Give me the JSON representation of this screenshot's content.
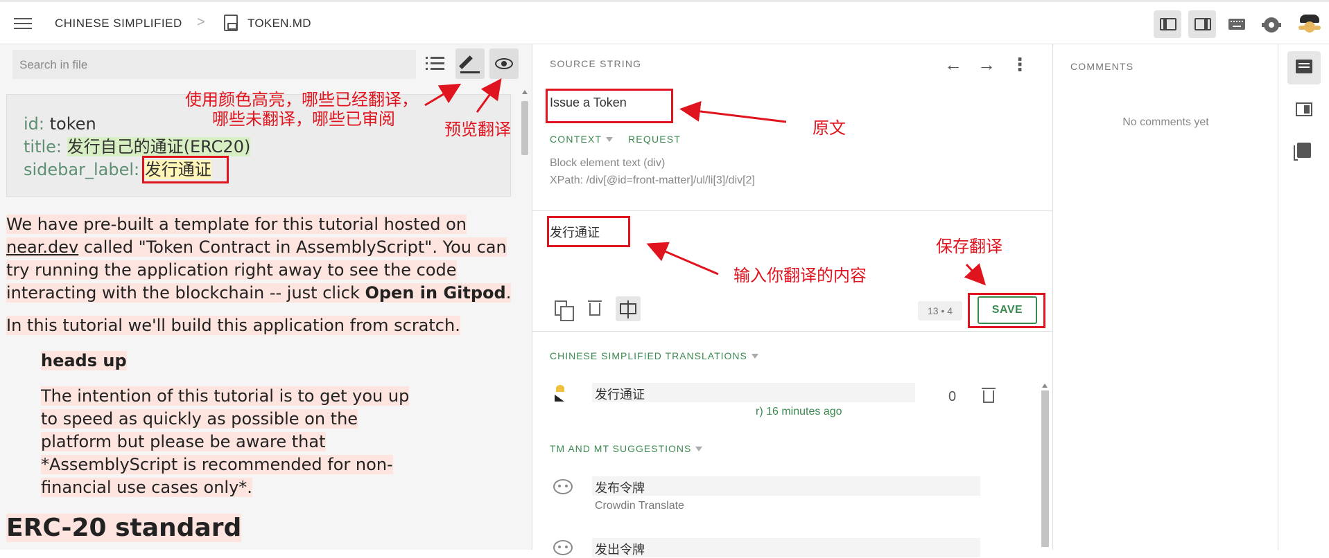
{
  "header": {
    "language": "CHINESE SIMPLIFIED",
    "separator": ">",
    "file": "TOKEN.MD",
    "icons": [
      "menu-icon",
      "file-icon",
      "layout-left-icon",
      "layout-right-icon",
      "keyboard-icon",
      "gear-icon",
      "avatar"
    ]
  },
  "left": {
    "search_placeholder": "Search in file",
    "front_matter": [
      {
        "key": "id:",
        "value": "token"
      },
      {
        "key": "title:",
        "value": "发行自己的通证(ERC20)"
      },
      {
        "key": "sidebar_label:",
        "value": "发行通证"
      }
    ],
    "para1_a": "We have pre-built a template for this tutorial hosted on",
    "para1_link": "near.dev",
    "para1_b": " called \"Token Contract in AssemblyScript\". You can try running the application right away to see the code interacting with the blockchain -- just click ",
    "para1_bold": "Open in Gitpod",
    "para1_end": ".",
    "para2": "In this tutorial we'll build this application from scratch.",
    "note_title": "heads up",
    "note_body": "The intention of this tutorial is to get you up to speed as quickly as possible on the platform but please be aware that *AssemblyScript is recommended for non-financial use cases only*.",
    "heading": "ERC-20 standard"
  },
  "editor": {
    "source_label": "SOURCE STRING",
    "source_text": "Issue a Token",
    "context_label": "CONTEXT",
    "request_label": "REQUEST",
    "meta_element": "Block element text (div)",
    "meta_xpath": "XPath: /div[@id=front-matter]/ul/li[3]/div[2]",
    "translation_text": "发行通证",
    "counter_a": "13",
    "counter_sep": "•",
    "counter_b": "4",
    "save_label": "SAVE",
    "translations_title": "CHINESE SIMPLIFIED TRANSLATIONS",
    "translation_row": {
      "text": "发行通证",
      "meta_tail": "r) 16 minutes ago",
      "votes": "0"
    },
    "suggestions_title": "TM AND MT SUGGESTIONS",
    "suggestions": [
      {
        "text": "发布令牌",
        "source": "Crowdin Translate"
      },
      {
        "text": "发出令牌",
        "source": ""
      }
    ]
  },
  "comments": {
    "title": "COMMENTS",
    "empty": "No comments yet"
  },
  "annotations": {
    "highlight_note_1": "使用颜色高亮，哪些已经翻译，",
    "highlight_note_2": "哪些未翻译，哪些已审阅",
    "preview_note": "预览翻译",
    "source_note": "原文",
    "input_note": "输入你翻译的内容",
    "save_note": "保存翻译",
    "color": "#e0141e"
  },
  "colors": {
    "accent": "#3a8a4f",
    "translated_highlight": "#d8efc4",
    "approved_highlight": "#fff6b8",
    "untranslated_highlight": "#fde4df"
  }
}
